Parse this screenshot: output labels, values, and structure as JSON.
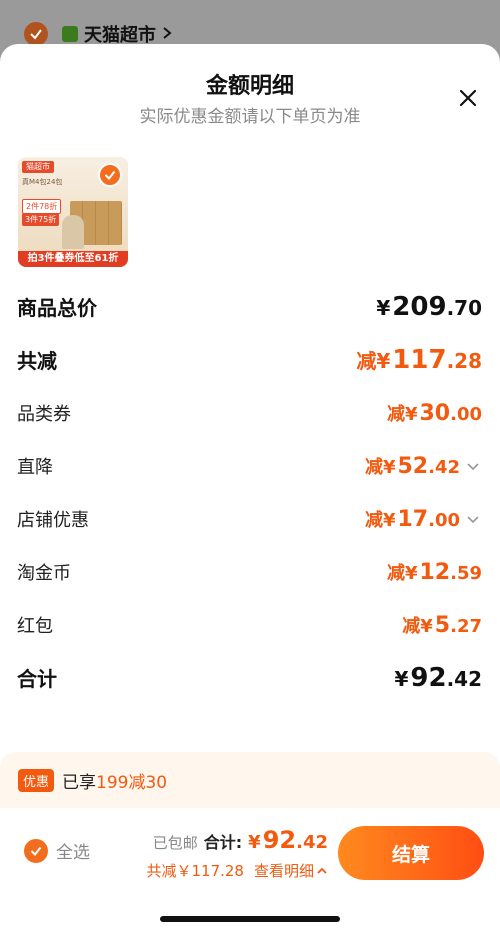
{
  "background_header": {
    "store_name": "天猫超市"
  },
  "sheet": {
    "title": "金额明细",
    "subtitle": "实际优惠金额请以下单页为准"
  },
  "product": {
    "tag": "猫超市",
    "line": "真M4包24包",
    "deal1": "2件78折",
    "deal2": "3件75折",
    "banner": "拍3件叠券低至61折"
  },
  "rows": [
    {
      "label": "商品总价",
      "prefix": "",
      "currency": "¥",
      "int": "209",
      "dec": ".70",
      "color": "#111111",
      "big": true,
      "chevron": false
    },
    {
      "label": "共减",
      "prefix": "减",
      "currency": "¥",
      "int": "117",
      "dec": ".28",
      "color": "#f25a0f",
      "big": true,
      "chevron": false
    },
    {
      "label": "品类券",
      "prefix": "减",
      "currency": "¥",
      "int": "30",
      "dec": ".00",
      "color": "#f25a0f",
      "big": false,
      "chevron": false
    },
    {
      "label": "直降",
      "prefix": "减",
      "currency": "¥",
      "int": "52",
      "dec": ".42",
      "color": "#f25a0f",
      "big": false,
      "chevron": true
    },
    {
      "label": "店铺优惠",
      "prefix": "减",
      "currency": "¥",
      "int": "17",
      "dec": ".00",
      "color": "#f25a0f",
      "big": false,
      "chevron": true
    },
    {
      "label": "淘金币",
      "prefix": "减",
      "currency": "¥",
      "int": "12",
      "dec": ".59",
      "color": "#f25a0f",
      "big": false,
      "chevron": false
    },
    {
      "label": "红包",
      "prefix": "减",
      "currency": "¥",
      "int": "5",
      "dec": ".27",
      "color": "#f25a0f",
      "big": false,
      "chevron": false
    },
    {
      "label": "合计",
      "prefix": "",
      "currency": "¥",
      "int": "92",
      "dec": ".42",
      "color": "#111111",
      "big": true,
      "chevron": false
    }
  ],
  "promo": {
    "badge": "优惠",
    "text_prefix": "已享",
    "text_highlight": "199减30"
  },
  "bottom": {
    "select_all": "全选",
    "free_shipping": "已包邮",
    "total_label": "合计:",
    "total_currency": "¥",
    "total_int": "92",
    "total_dec": ".42",
    "saved": "共减￥117.28",
    "view_detail": "查看明细",
    "checkout": "结算"
  },
  "colors": {
    "accent": "#f25a0f",
    "checkout_gradient_start": "#ff8a1e",
    "checkout_gradient_end": "#ff4e13"
  }
}
